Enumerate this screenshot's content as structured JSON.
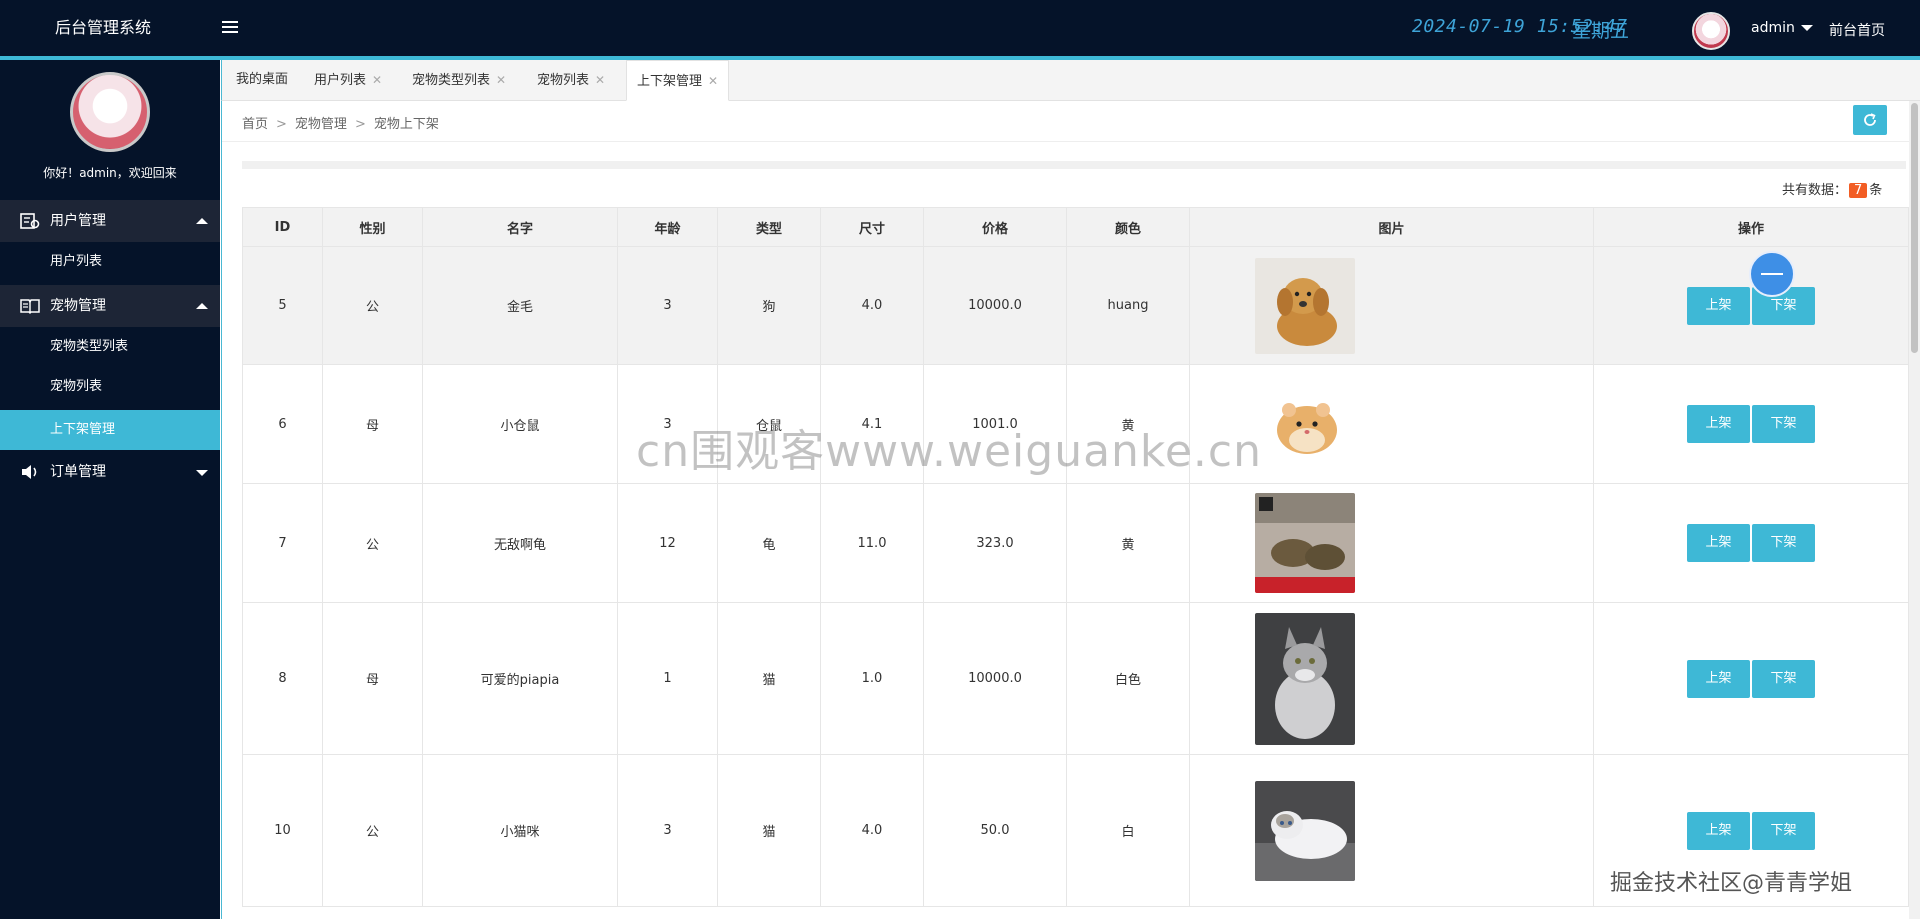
{
  "header": {
    "logo": "后台管理系统",
    "clock": "2024-07-19 15:52:47",
    "weekday": "星期五",
    "admin_name": "admin",
    "front_link": "前台首页"
  },
  "sidebar": {
    "welcome": "你好！admin，欢迎回来",
    "groups": [
      {
        "label": "用户管理",
        "icon": "user-manage-icon",
        "expanded": true,
        "items": [
          {
            "label": "用户列表"
          }
        ]
      },
      {
        "label": "宠物管理",
        "icon": "book-icon",
        "expanded": true,
        "items": [
          {
            "label": "宠物类型列表"
          },
          {
            "label": "宠物列表"
          },
          {
            "label": "上下架管理",
            "active": true
          }
        ]
      },
      {
        "label": "订单管理",
        "icon": "speaker-icon",
        "expanded": false,
        "items": []
      }
    ]
  },
  "tabs": [
    {
      "label": "我的桌面",
      "closable": false
    },
    {
      "label": "用户列表",
      "closable": true
    },
    {
      "label": "宠物类型列表",
      "closable": true
    },
    {
      "label": "宠物列表",
      "closable": true
    },
    {
      "label": "上下架管理",
      "closable": true,
      "active": true
    }
  ],
  "breadcrumb": [
    "首页",
    "宠物管理",
    "宠物上下架"
  ],
  "total": {
    "prefix": "共有数据：",
    "count": "7",
    "suffix": "条"
  },
  "table": {
    "columns": [
      "ID",
      "性别",
      "名字",
      "年龄",
      "类型",
      "尺寸",
      "价格",
      "颜色",
      "图片",
      "操作"
    ],
    "rows": [
      {
        "id": "5",
        "gender": "公",
        "name": "金毛",
        "age": "3",
        "type": "狗",
        "size": "4.0",
        "price": "10000.0",
        "color": "huang",
        "image": "golden-retriever-puppy"
      },
      {
        "id": "6",
        "gender": "母",
        "name": "小仓鼠",
        "age": "3",
        "type": "仓鼠",
        "size": "4.1",
        "price": "1001.0",
        "color": "黄",
        "image": "hamster"
      },
      {
        "id": "7",
        "gender": "公",
        "name": "无敌啊龟",
        "age": "12",
        "type": "龟",
        "size": "11.0",
        "price": "323.0",
        "color": "黄",
        "image": "turtle"
      },
      {
        "id": "8",
        "gender": "母",
        "name": "可爱的piapia",
        "age": "1",
        "type": "猫",
        "size": "1.0",
        "price": "10000.0",
        "color": "白色",
        "image": "maine-coon-cat"
      },
      {
        "id": "10",
        "gender": "公",
        "name": "小猫咪",
        "age": "3",
        "type": "猫",
        "size": "4.0",
        "price": "50.0",
        "color": "白",
        "image": "ragdoll-cat"
      }
    ],
    "op_on": "上架",
    "op_off": "下架"
  },
  "watermark": "cn围观客www.weiguanke.cn",
  "corner_mark": "掘金技术社区@青青学姐",
  "colors": {
    "accent": "#3eb8d6",
    "header_bg": "#051329",
    "count_badge": "#f25d24",
    "clock": "#3ea4d8"
  }
}
